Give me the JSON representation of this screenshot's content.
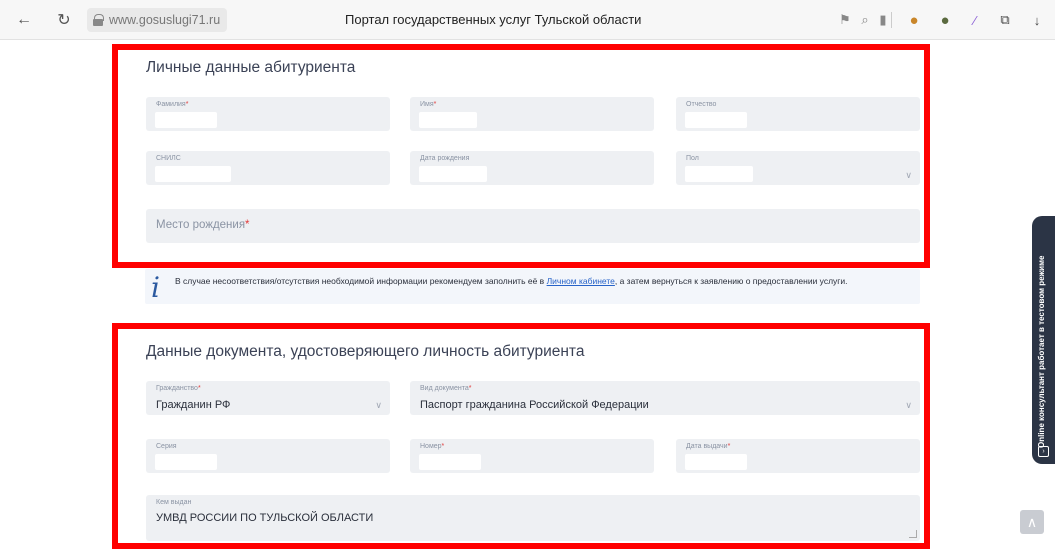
{
  "browser": {
    "url": "www.gosuslugi71.ru",
    "title": "Портал государственных услуг Тульской области",
    "icons": [
      "back-arrow-icon",
      "reload-icon",
      "lock-icon",
      "translate-icon",
      "search-icon",
      "bookmark-icon",
      "extension-icon",
      "extension-icon",
      "pen-icon",
      "share-icon",
      "download-icon"
    ]
  },
  "personal": {
    "title": "Личные данные абитуриента",
    "surname_label": "Фамилия",
    "name_label": "Имя",
    "patronymic_label": "Отчество",
    "snils_label": "СНИЛС",
    "birthdate_label": "Дата рождения",
    "gender_label": "Пол",
    "birthplace_label": "Место рождения",
    "required_mark": "*"
  },
  "info": {
    "text_before": "В случае несоответствия/отсутствия необходимой информации рекомендуем заполнить её в ",
    "link": "Личном кабинете",
    "text_after": ", а затем вернуться к заявлению о предоставлении услуги."
  },
  "document": {
    "title": "Данные документа, удостоверяющего личность абитуриента",
    "citizenship_label": "Гражданство",
    "citizenship_value": "Гражданин РФ",
    "doc_type_label": "Вид документа",
    "doc_type_value": "Паспорт гражданина Российской Федерации",
    "series_label": "Серия",
    "number_label": "Номер",
    "issue_date_label": "Дата выдачи",
    "issued_by_label": "Кем выдан",
    "issued_by_value": "УМВД РОССИИ ПО ТУЛЬСКОЙ ОБЛАСТИ",
    "required_mark": "*"
  },
  "side_tab": {
    "text": "Online консультант работает в тестовом режиме"
  },
  "colors": {
    "highlight": "#ff0000",
    "field_bg": "#eef0f3",
    "link": "#2763c8",
    "side_tab_bg": "#2b3445"
  }
}
